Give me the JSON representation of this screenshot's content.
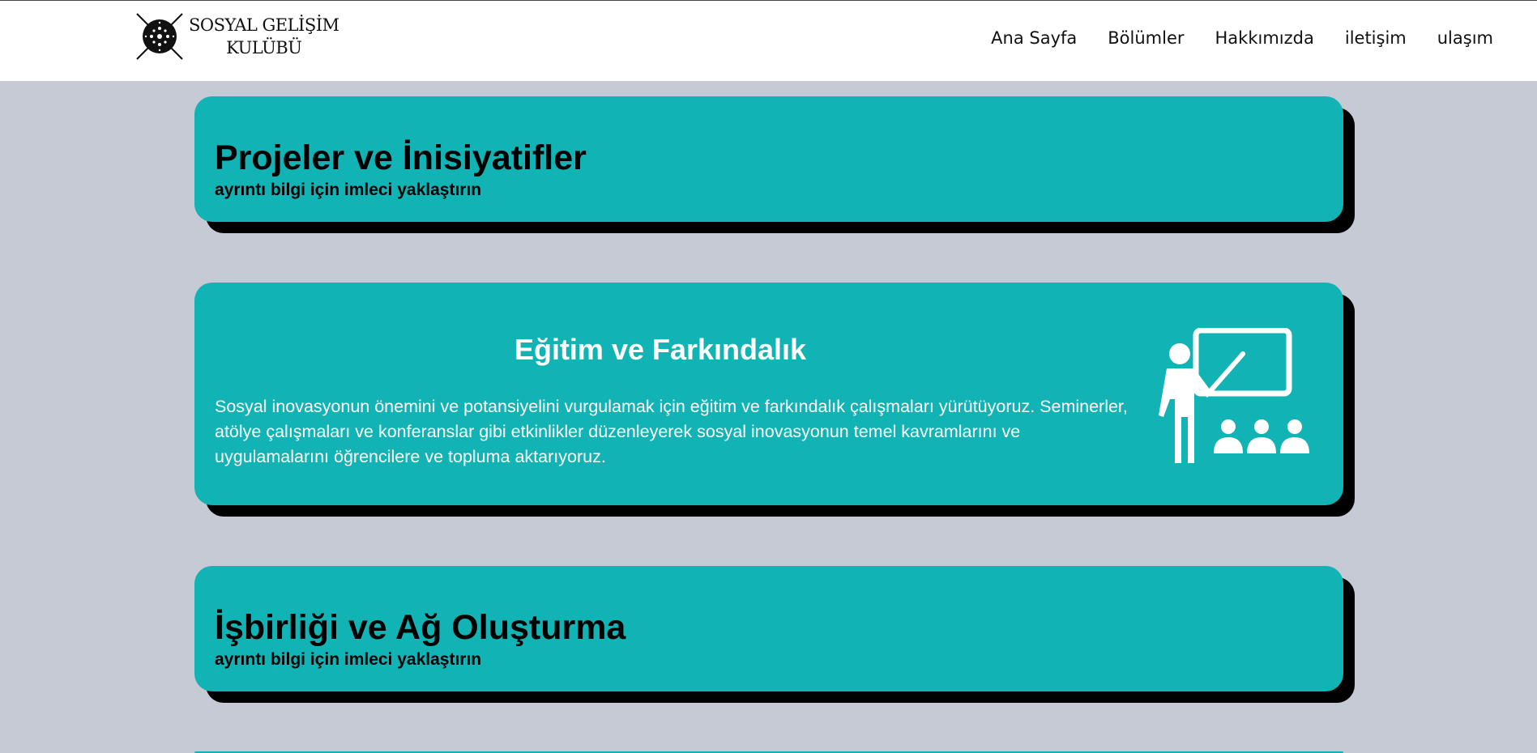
{
  "brand": {
    "line1": "SOSYAL GELİŞİM",
    "line2": "KULÜBÜ",
    "logo_icon": "club-emblem-icon"
  },
  "nav": {
    "items": [
      {
        "label": "Ana Sayfa"
      },
      {
        "label": "Bölümler"
      },
      {
        "label": "Hakkımızda"
      },
      {
        "label": "iletişim"
      },
      {
        "label": "ulaşım"
      }
    ]
  },
  "cards": [
    {
      "title": "Projeler ve İnisiyatifler",
      "subtitle": "ayrıntı bilgi için imleci yaklaştırın",
      "expanded": false
    },
    {
      "title": "Eğitim ve Farkındalık",
      "body": "Sosyal inovasyonun önemini ve potansiyelini vurgulamak için eğitim ve farkındalık çalışmaları yürütüyoruz. Seminerler, atölye çalışmaları ve konferanslar gibi etkinlikler düzenleyerek sosyal inovasyonun temel kavramlarını ve uygulamalarını öğrencilere ve topluma aktarıyoruz.",
      "icon": "teacher-classroom-icon",
      "expanded": true
    },
    {
      "title": "İşbirliği ve Ağ Oluşturma",
      "subtitle": "ayrıntı bilgi için imleci yaklaştırın",
      "expanded": false
    }
  ],
  "colors": {
    "background": "#c6cad4",
    "card": "#11b3b4",
    "card_shadow": "#000000",
    "navbar": "#ffffff"
  }
}
